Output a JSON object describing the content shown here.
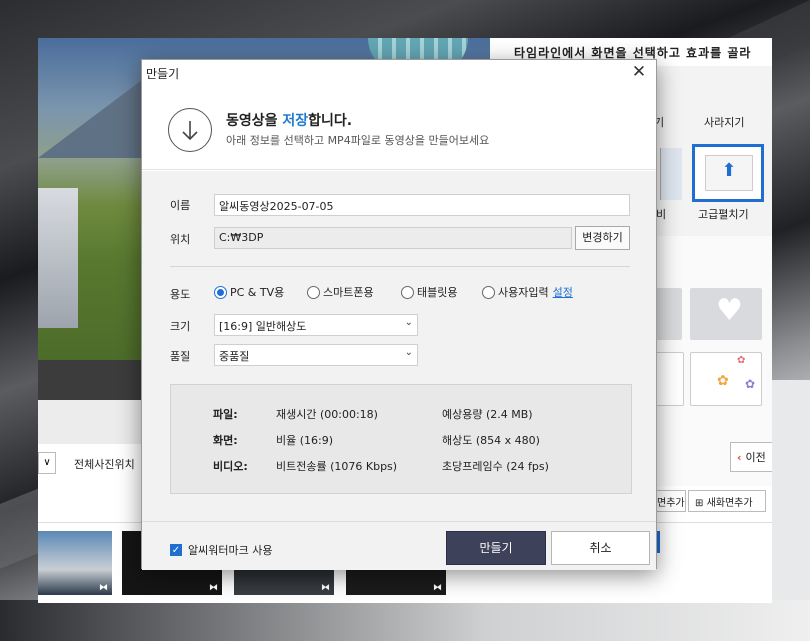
{
  "app": {
    "hint": "타임라인에서 화면을 선택하고 효과를 골라",
    "effects": {
      "partial_label": "기",
      "disappear_label": "사라지기",
      "partial_label2": "비",
      "advanced_label": "고급펼치기"
    },
    "filter_select": "∨",
    "filter_label": "전체사진위치",
    "prev_button": "이전",
    "add_button_partial": "면추가",
    "add_new_button": "새화면추가"
  },
  "dialog": {
    "title": "만들기",
    "header": {
      "title_prefix": "동영상을 ",
      "title_accent": "저장",
      "title_suffix": "합니다.",
      "subtitle": "아래 정보를 선택하고 MP4파일로 동영상을 만들어보세요"
    },
    "fields": {
      "name_label": "이름",
      "name_value": "알씨동영상2025-07-05",
      "location_label": "위치",
      "location_value": "C:₩3DP",
      "change_button": "변경하기",
      "purpose_label": "용도",
      "purpose_options": [
        "PC & TV용",
        "스마트폰용",
        "태블릿용",
        "사용자입력"
      ],
      "purpose_selected": "PC & TV용",
      "settings_link": "설정",
      "size_label": "크기",
      "size_value": "[16:9] 일반해상도",
      "quality_label": "품질",
      "quality_value": "중품질"
    },
    "info": {
      "file_label": "파일:",
      "file_v1": "재생시간 (00:00:18)",
      "file_v2": "예상용량 (2.4 MB)",
      "screen_label": "화면:",
      "screen_v1": "비율 (16:9)",
      "screen_v2": "해상도 (854 x 480)",
      "video_label": "비디오:",
      "video_v1": "비트전송률 (1076 Kbps)",
      "video_v2": "초당프레임수 (24 fps)"
    },
    "footer": {
      "watermark_label": "알씨워터마크 사용",
      "watermark_checked": true,
      "make_button": "만들기",
      "cancel_button": "취소"
    }
  },
  "colors": {
    "accent": "#1f7ad1",
    "primary_button": "#3d4159"
  }
}
